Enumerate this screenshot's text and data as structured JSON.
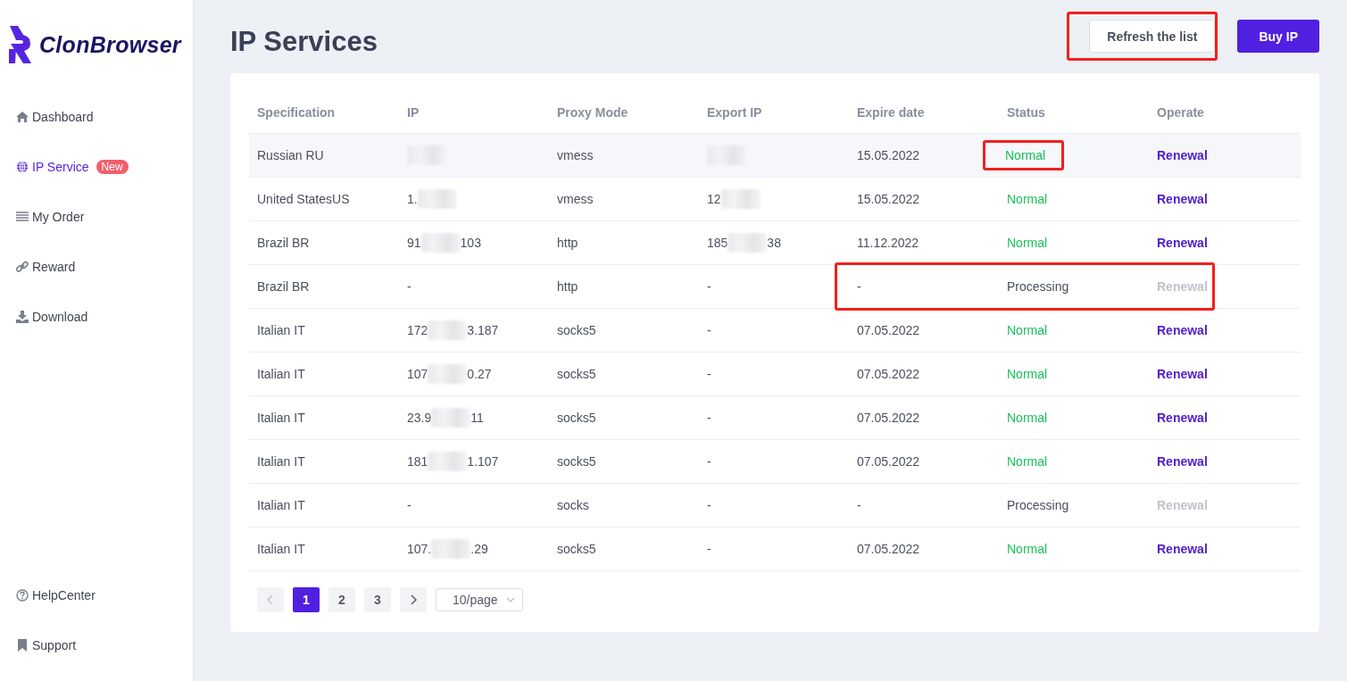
{
  "sidebar": {
    "brand": "ClonBrowser",
    "items": [
      {
        "label": "Dashboard",
        "selected": false
      },
      {
        "label": "IP Service",
        "selected": true,
        "badge": "New"
      },
      {
        "label": "My Order",
        "selected": false
      },
      {
        "label": "Reward",
        "selected": false
      },
      {
        "label": "Download",
        "selected": false
      }
    ],
    "bottom_items": [
      {
        "label": "HelpCenter"
      },
      {
        "label": "Support"
      }
    ]
  },
  "page": {
    "title": "IP Services",
    "buttons": [
      {
        "label": "Refresh the list",
        "kind": "secondary",
        "highlighted": true
      },
      {
        "label": "Buy IP",
        "kind": "primary",
        "highlighted": false
      }
    ]
  },
  "table": {
    "columns": [
      "Specification",
      "IP",
      "Proxy Mode",
      "Export IP",
      "Expire date",
      "Status",
      "Operate"
    ],
    "rows": [
      {
        "specification": "Russian RU",
        "ip": {
          "redacted": true
        },
        "proxy_mode": "vmess",
        "export_ip": {
          "redacted": true
        },
        "expire_date": "15.05.2022",
        "status": {
          "text": "Normal",
          "kind": "normal",
          "highlighted": true
        },
        "operate": {
          "text": "Renewal",
          "disabled": false
        },
        "hovered": true,
        "highlighted": false
      },
      {
        "specification": "United StatesUS",
        "ip": {
          "start": "1.",
          "redacted": true
        },
        "proxy_mode": "vmess",
        "export_ip": {
          "start": "12",
          "redacted": true
        },
        "expire_date": "15.05.2022",
        "status": {
          "text": "Normal",
          "kind": "normal",
          "highlighted": false
        },
        "operate": {
          "text": "Renewal",
          "disabled": false
        },
        "hovered": false,
        "highlighted": false
      },
      {
        "specification": "Brazil BR",
        "ip": {
          "start": "91",
          "end": "103",
          "redacted": true
        },
        "proxy_mode": "http",
        "export_ip": {
          "start": "185",
          "end": "38",
          "redacted": true
        },
        "expire_date": "11.12.2022",
        "status": {
          "text": "Normal",
          "kind": "normal",
          "highlighted": false
        },
        "operate": {
          "text": "Renewal",
          "disabled": false
        },
        "hovered": false,
        "highlighted": false
      },
      {
        "specification": "Brazil BR",
        "ip": {
          "start": "-",
          "redacted": false
        },
        "proxy_mode": "http",
        "export_ip": {
          "start": "-",
          "redacted": false
        },
        "expire_date": "-",
        "status": {
          "text": "Processing",
          "kind": "processing",
          "highlighted": false
        },
        "operate": {
          "text": "Renewal",
          "disabled": true
        },
        "hovered": false,
        "highlighted": true
      },
      {
        "specification": "Italian IT",
        "ip": {
          "start": "172",
          "end": "3.187",
          "redacted": true
        },
        "proxy_mode": "socks5",
        "export_ip": {
          "start": "-",
          "redacted": false
        },
        "expire_date": "07.05.2022",
        "status": {
          "text": "Normal",
          "kind": "normal",
          "highlighted": false
        },
        "operate": {
          "text": "Renewal",
          "disabled": false
        },
        "hovered": false,
        "highlighted": false
      },
      {
        "specification": "Italian IT",
        "ip": {
          "start": "107",
          "end": "0.27",
          "redacted": true
        },
        "proxy_mode": "socks5",
        "export_ip": {
          "start": "-",
          "redacted": false
        },
        "expire_date": "07.05.2022",
        "status": {
          "text": "Normal",
          "kind": "normal",
          "highlighted": false
        },
        "operate": {
          "text": "Renewal",
          "disabled": false
        },
        "hovered": false,
        "highlighted": false
      },
      {
        "specification": "Italian IT",
        "ip": {
          "start": "23.9",
          "end": "11",
          "redacted": true
        },
        "proxy_mode": "socks5",
        "export_ip": {
          "start": "-",
          "redacted": false
        },
        "expire_date": "07.05.2022",
        "status": {
          "text": "Normal",
          "kind": "normal",
          "highlighted": false
        },
        "operate": {
          "text": "Renewal",
          "disabled": false
        },
        "hovered": false,
        "highlighted": false
      },
      {
        "specification": "Italian IT",
        "ip": {
          "start": "181",
          "end": "1.107",
          "redacted": true
        },
        "proxy_mode": "socks5",
        "export_ip": {
          "start": "-",
          "redacted": false
        },
        "expire_date": "07.05.2022",
        "status": {
          "text": "Normal",
          "kind": "normal",
          "highlighted": false
        },
        "operate": {
          "text": "Renewal",
          "disabled": false
        },
        "hovered": false,
        "highlighted": false
      },
      {
        "specification": "Italian IT",
        "ip": {
          "start": "-",
          "redacted": false
        },
        "proxy_mode": "socks",
        "export_ip": {
          "start": "-",
          "redacted": false
        },
        "expire_date": "-",
        "status": {
          "text": "Processing",
          "kind": "processing",
          "highlighted": false
        },
        "operate": {
          "text": "Renewal",
          "disabled": true
        },
        "hovered": false,
        "highlighted": false
      },
      {
        "specification": "Italian IT",
        "ip": {
          "start": "107.",
          "end": ".29",
          "redacted": true
        },
        "proxy_mode": "socks5",
        "export_ip": {
          "start": "-",
          "redacted": false
        },
        "expire_date": "07.05.2022",
        "status": {
          "text": "Normal",
          "kind": "normal",
          "highlighted": false
        },
        "operate": {
          "text": "Renewal",
          "disabled": false
        },
        "hovered": false,
        "highlighted": false
      }
    ]
  },
  "pagination": {
    "prev_disabled": true,
    "pages": [
      {
        "label": "1",
        "selected": true
      },
      {
        "label": "2",
        "selected": false
      },
      {
        "label": "3",
        "selected": false
      }
    ],
    "next_disabled": false,
    "page_size": "10/page"
  }
}
